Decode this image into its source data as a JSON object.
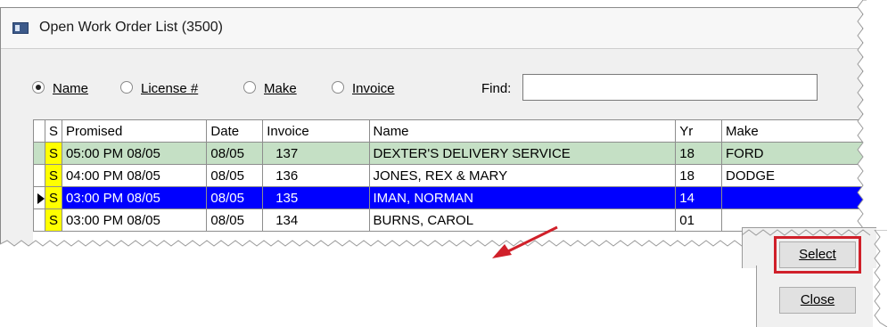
{
  "window": {
    "title": "Open Work Order List (3500)"
  },
  "filters": {
    "options": [
      {
        "label": "Name",
        "selected": true
      },
      {
        "label": "License #",
        "selected": false
      },
      {
        "label": "Make",
        "selected": false
      },
      {
        "label": "Invoice",
        "selected": false
      }
    ],
    "find_label": "Find:",
    "find_value": ""
  },
  "grid": {
    "columns": [
      "S",
      "Promised",
      "Date",
      "Invoice",
      "Name",
      "Yr",
      "Make"
    ],
    "rows": [
      {
        "s": "S",
        "promised": "05:00 PM 08/05",
        "date": "08/05",
        "invoice": "137",
        "name": "DEXTER'S DELIVERY SERVICE",
        "yr": "18",
        "make": "FORD",
        "state": "highlight"
      },
      {
        "s": "S",
        "promised": "04:00 PM 08/05",
        "date": "08/05",
        "invoice": "136",
        "name": "JONES, REX & MARY",
        "yr": "18",
        "make": "DODGE",
        "state": "normal"
      },
      {
        "s": "S",
        "promised": "03:00 PM 08/05",
        "date": "08/05",
        "invoice": "135",
        "name": "IMAN, NORMAN",
        "yr": "14",
        "make": "",
        "state": "selected"
      },
      {
        "s": "S",
        "promised": "03:00 PM 08/05",
        "date": "08/05",
        "invoice": "134",
        "name": "BURNS, CAROL",
        "yr": "01",
        "make": "",
        "state": "normal"
      }
    ]
  },
  "buttons": {
    "select": "Select",
    "close": "Close"
  },
  "colors": {
    "selected_row": "#0000ff",
    "highlight_row": "#c5e0c5",
    "status_cell": "#ffff00",
    "annotation": "#d0202a"
  }
}
